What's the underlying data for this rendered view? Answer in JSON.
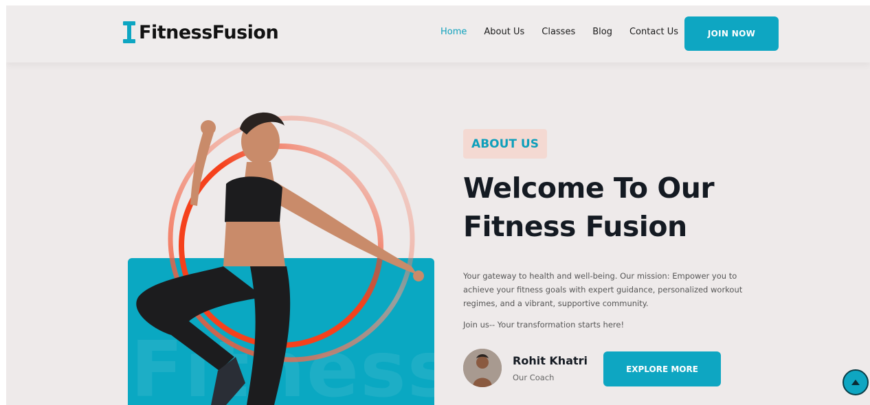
{
  "header": {
    "logo_text": "FitnessFusion",
    "nav": [
      {
        "label": "Home",
        "active": true
      },
      {
        "label": "About Us",
        "active": false
      },
      {
        "label": "Classes",
        "active": false
      },
      {
        "label": "Blog",
        "active": false
      },
      {
        "label": "Contact Us",
        "active": false
      }
    ],
    "join_label": "JOIN NOW"
  },
  "hero": {
    "watermark": "Fitness",
    "tag": "ABOUT US",
    "headline_line1": "Welcome To Our",
    "headline_line2": "Fitness Fusion",
    "description": "Your gateway to health and well-being. Our mission: Empower you to achieve your fitness goals with expert guidance, personalized workout regimes, and a vibrant, supportive community.",
    "cta_line": "Join us-- Your transformation starts here!",
    "coach": {
      "name": "Rohit Khatri",
      "role": "Our Coach"
    },
    "explore_label": "EXPLORE MORE"
  },
  "icons": {
    "logo": "dumbbell-icon",
    "scroll_top": "arrow-up-icon"
  },
  "colors": {
    "accent": "#0ea6c2",
    "ring": "#f5411c",
    "tag_bg": "#f4d9d2",
    "page_bg": "#eeeaea"
  }
}
